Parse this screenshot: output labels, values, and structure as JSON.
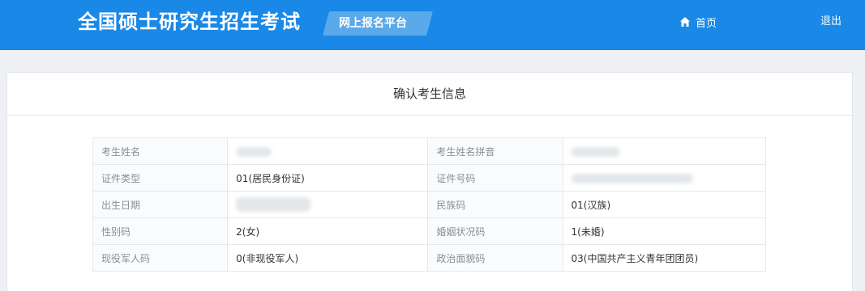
{
  "header": {
    "brand": "全国硕士研究生招生考试",
    "platform": "网上报名平台",
    "home_label": "首页",
    "logout_label": "退出",
    "bg_color": "#1a88e6"
  },
  "panel": {
    "title": "确认考生信息"
  },
  "info": {
    "rows": [
      {
        "label_a": "考生姓名",
        "value_a": "",
        "label_b": "考生姓名拼音",
        "value_b": ""
      },
      {
        "label_a": "证件类型",
        "value_a": "01(居民身份证)",
        "label_b": "证件号码",
        "value_b": ""
      },
      {
        "label_a": "出生日期",
        "value_a": "",
        "label_b": "民族码",
        "value_b": "01(汉族)"
      },
      {
        "label_a": "性别码",
        "value_a": "2(女)",
        "label_b": "婚姻状况码",
        "value_b": "1(未婚)"
      },
      {
        "label_a": "现役军人码",
        "value_a": "0(非现役军人)",
        "label_b": "政治面貌码",
        "value_b": "03(中国共产主义青年团团员)"
      }
    ]
  }
}
